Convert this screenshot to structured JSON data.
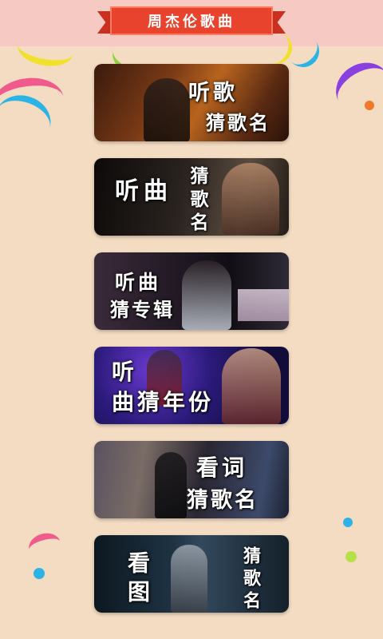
{
  "header": {
    "title": "周杰伦歌曲"
  },
  "cards": [
    {
      "name": "listen-song-guess-name",
      "label_a": "听歌",
      "label_b": "猜歌名",
      "bg": "#6a3118"
    },
    {
      "name": "listen-tune-guess-name",
      "label_a": "听曲",
      "label_b": "猜歌名",
      "bg": "#1c1a18"
    },
    {
      "name": "listen-tune-guess-album",
      "label_a": "听曲",
      "label_b": "猜专辑",
      "bg": "#241f28"
    },
    {
      "name": "listen-tune-guess-year",
      "label_a": "听",
      "label_b": "曲猜年份",
      "bg": "#231a55"
    },
    {
      "name": "read-lyrics-guess-name",
      "label_a": "看词",
      "label_b": "猜歌名",
      "bg": "#1e2230"
    },
    {
      "name": "view-picture-guess-name",
      "label_a": "看图",
      "label_b": "猜歌名",
      "bg": "#13202b"
    }
  ],
  "colors": {
    "page_bg": "#f3dcc2",
    "header_bg": "#f6c9c2",
    "banner": "#e8442d",
    "confetti_yellow": "#f2e12a",
    "confetti_pink": "#f05a8c",
    "confetti_blue": "#2cb3e6",
    "confetti_purple": "#8a3fe0",
    "confetti_orange": "#f07a2a",
    "confetti_green": "#b6e04a"
  }
}
